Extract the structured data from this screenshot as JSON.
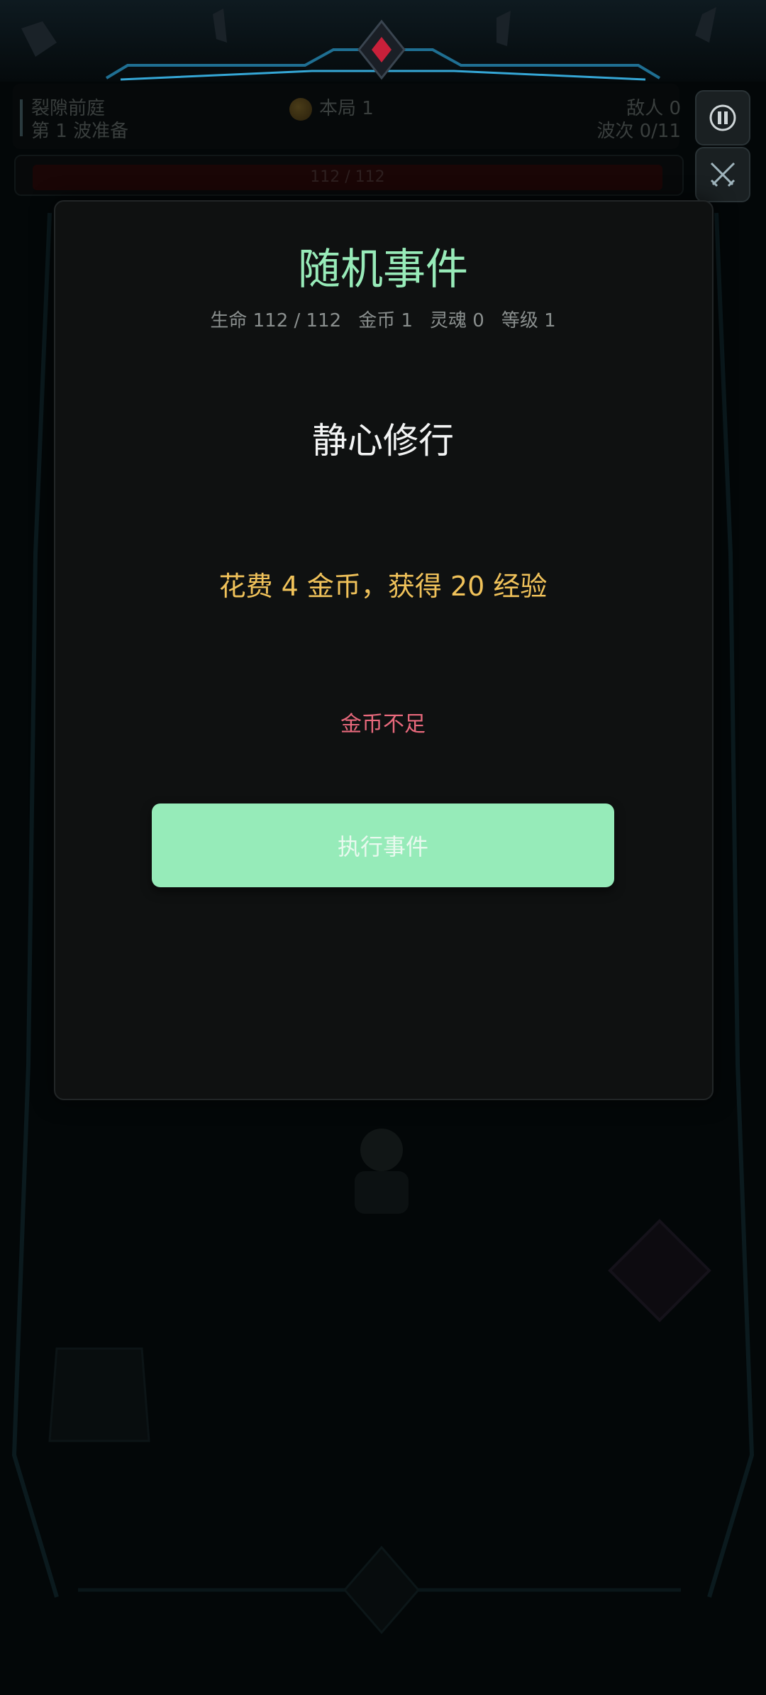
{
  "hud": {
    "stage_name": "裂隙前庭",
    "wave_status": "第 1 波准备",
    "round_gold": "本局 1",
    "enemies": "敌人 0",
    "waves": "波次 0/11",
    "hp_bar_text": "112 / 112"
  },
  "modal": {
    "title": "随机事件",
    "stats": {
      "hp": "生命 112 / 112",
      "gold": "金币 1",
      "soul": "灵魂 0",
      "level": "等级 1"
    },
    "event_name": "静心修行",
    "event_description": "花费 4 金币，获得 20 经验",
    "warning": "金币不足",
    "execute_button": "执行事件"
  },
  "icons": {
    "pause": "pause-icon",
    "battle": "crossed-swords-icon",
    "coin": "coin-icon"
  },
  "colors": {
    "title_accent": "#98ebb9",
    "gold_text": "#f0c25a",
    "warning_text": "#e8697c",
    "button_bg": "#96ebb9"
  }
}
